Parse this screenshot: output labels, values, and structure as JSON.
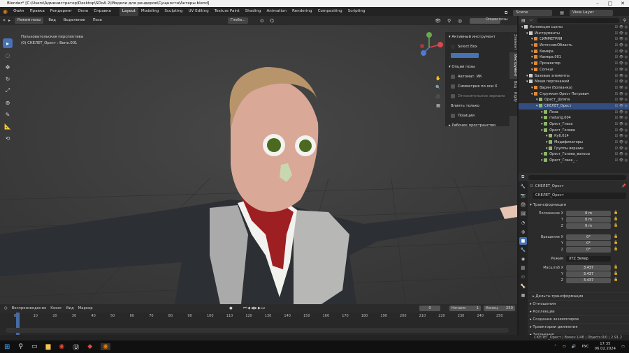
{
  "window": {
    "title": "Blender* [C:\\Users\\Администратор\\Desktop\\SDoA 2\\Модели для рендеров\\Сущности\\Актеры.blend]"
  },
  "menu": [
    "Файл",
    "Правка",
    "Рендеринг",
    "Окно",
    "Справка"
  ],
  "workspaces": [
    "Layout",
    "Modeling",
    "Sculpting",
    "UV Editing",
    "Texture Paint",
    "Shading",
    "Animation",
    "Rendering",
    "Compositing",
    "Scripting"
  ],
  "scene": {
    "name": "Scene",
    "view_layer": "View Layer"
  },
  "viewport_header": {
    "mode": "Режим позы",
    "view": "Вид",
    "select": "Выделение",
    "pose": "Поза",
    "orientation": "Глоба...",
    "options": "Опции позы"
  },
  "viewport": {
    "perspective": "Пользовательская перспектива",
    "object_info": "(0) СКЕЛЕТ_Орест : Bone.001"
  },
  "npanel": {
    "active_tool": "Активный инструмент",
    "select_box": "Select Box",
    "pose_options": "Опции позы",
    "auto_ik": "Автомат. ИК",
    "x_mirror": "Симметрия по оси X",
    "relative_mirror": "Относительное зеркало",
    "affect_only": "Влиять только",
    "locations": "Позиции",
    "workspace": "Рабочее пространство"
  },
  "side_tabs": [
    "Элемент",
    "Инструмент",
    "Вид",
    "Rigify"
  ],
  "outliner": {
    "items": [
      {
        "label": "Коллекция сцены",
        "indent": 0
      },
      {
        "label": "Инструменты",
        "indent": 1
      },
      {
        "label": "СИММЕТРИЯ",
        "indent": 2
      },
      {
        "label": "ИсточникОбласть",
        "indent": 2
      },
      {
        "label": "Камера",
        "indent": 2
      },
      {
        "label": "Камера.001",
        "indent": 2
      },
      {
        "label": "Прожектор",
        "indent": 2
      },
      {
        "label": "Солнце",
        "indent": 2
      },
      {
        "label": "Базовые элементы",
        "indent": 1
      },
      {
        "label": "Меши персонажей",
        "indent": 1
      },
      {
        "label": "Варин (Болванка)",
        "indent": 2
      },
      {
        "label": "Стружкин Орест Петрович",
        "indent": 2
      },
      {
        "label": "Орест_Шляпа",
        "indent": 3
      },
      {
        "label": "СКЕЛЕТ_Орест",
        "indent": 3
      },
      {
        "label": "Поза",
        "indent": 4
      },
      {
        "label": "metarig.004",
        "indent": 4
      },
      {
        "label": "Орест_Глаза",
        "indent": 4
      },
      {
        "label": "Орест_Голова",
        "indent": 4
      },
      {
        "label": "Куб.014",
        "indent": 5
      },
      {
        "label": "Модификаторы",
        "indent": 5
      },
      {
        "label": "Группы вершин",
        "indent": 5
      },
      {
        "label": "Орест_Голова_волосы",
        "indent": 4
      },
      {
        "label": "Орест_Глаза_...",
        "indent": 4
      }
    ]
  },
  "properties": {
    "object_name": "СКЕЛЕТ_Орест",
    "object_field": "СКЕЛЕТ_Орест",
    "transform": "Трансформация",
    "location_x_label": "Положение X",
    "location_x": "0 m",
    "location_y_label": "Y",
    "location_y": "0 m",
    "location_z_label": "Z",
    "location_z": "0 m",
    "rotation_x_label": "Вращение X",
    "rotation_x": "0°",
    "rotation_y_label": "Y",
    "rotation_y": "0°",
    "rotation_z_label": "Z",
    "rotation_z": "0°",
    "mode_label": "Режим",
    "mode": "XYZ Эйлер",
    "scale_x_label": "Масштаб X",
    "scale_x": "3.437",
    "scale_y_label": "Y",
    "scale_y": "3.437",
    "scale_z_label": "Z",
    "scale_z": "3.437",
    "delta": "Дельта-трансформация",
    "sections": [
      "Отношения",
      "Коллекции",
      "Создание экземпляров",
      "Траектории движения",
      "Затенение"
    ]
  },
  "timeline": {
    "playback": "Воспроизведение",
    "keying": "Кеинг",
    "view": "Вид",
    "marker": "Маркер",
    "current_frame": "0",
    "start_label": "Начало",
    "start": "1",
    "end_label": "Конец",
    "end": "250",
    "ticks": [
      "0",
      "10",
      "20",
      "30",
      "40",
      "50",
      "60",
      "70",
      "80",
      "90",
      "100",
      "110",
      "120",
      "130",
      "140",
      "150",
      "160",
      "170",
      "180",
      "190",
      "200",
      "210",
      "220",
      "230",
      "240",
      "250"
    ]
  },
  "status": {
    "text": "СКЕЛЕТ_Орест | Bones:1/48 | Objects:0/0 | 2.91.2"
  },
  "taskbar": {
    "lang": "РУС",
    "time": "17:35",
    "date": "06.02.2024"
  },
  "colors": {
    "accent": "#4772b3",
    "bg": "#3c3c3c"
  }
}
